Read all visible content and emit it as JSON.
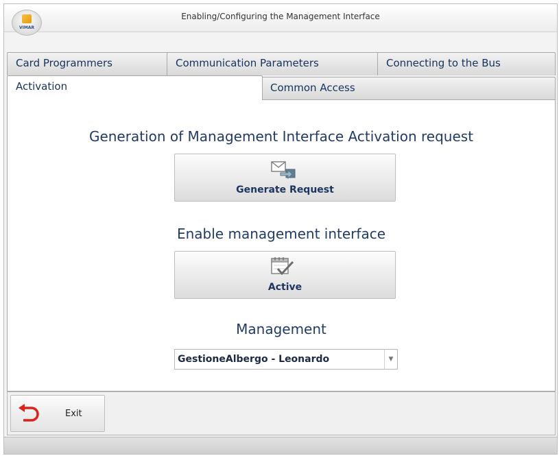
{
  "window": {
    "title": "Enabling/Configuring the Management Interface",
    "logo_text": "VIMAR"
  },
  "tabs": {
    "row1": [
      "Card Programmers",
      "Communication Parameters",
      "Connecting to the Bus"
    ],
    "row2": [
      "Activation",
      "Common Access"
    ],
    "active": "Activation"
  },
  "activation": {
    "request_heading": "Generation of Management Interface Activation request",
    "generate_button": "Generate Request",
    "enable_heading": "Enable management interface",
    "active_button": "Active",
    "management_heading": "Management",
    "management_select_value": "GestioneAlbergo - Leonardo"
  },
  "footer": {
    "exit_label": "Exit"
  },
  "icons": {
    "generate": "envelope-arrow-icon",
    "active": "calendar-check-icon",
    "exit": "exit-arrow-icon",
    "dropdown": "chevron-down-icon"
  },
  "colors": {
    "text_accent": "#213b66",
    "exit_icon": "#e0201a"
  }
}
